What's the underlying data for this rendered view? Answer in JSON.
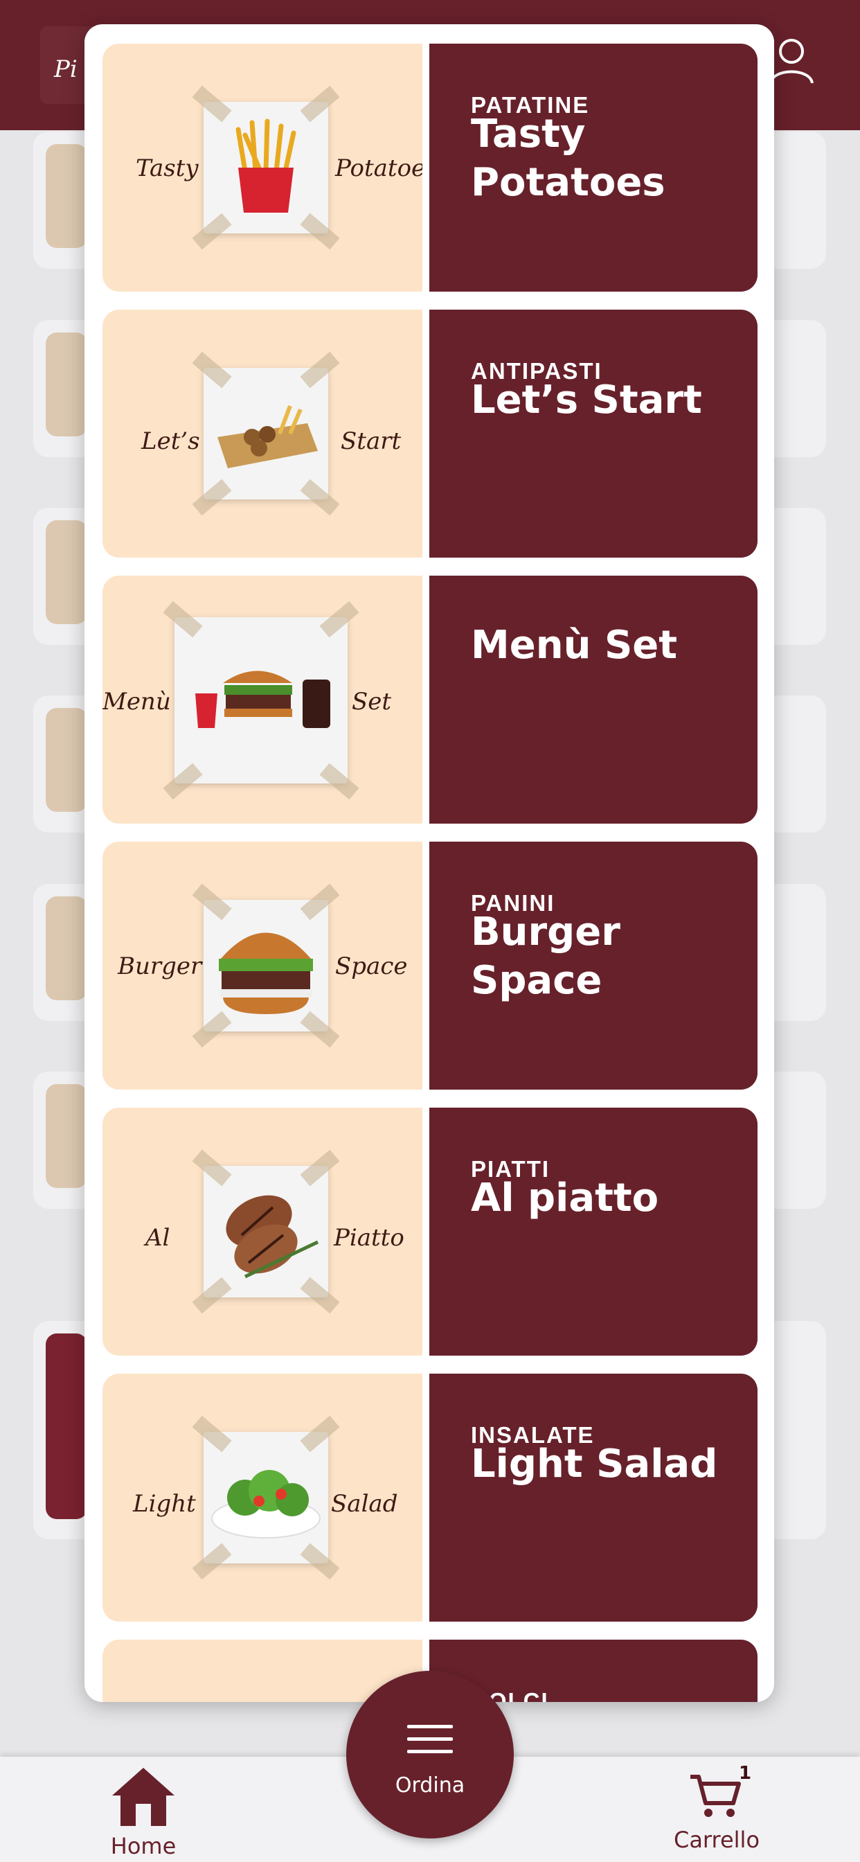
{
  "header": {
    "logo_text": "Pi"
  },
  "modal": {
    "categories": [
      {
        "subtitle": "PATATINE",
        "title": "Tasty Potatoes",
        "script_left": "Tasty",
        "script_right": "Potatoes",
        "image_icon": "fries-icon"
      },
      {
        "subtitle": "ANTIPASTI",
        "title": "Let’s Start",
        "script_left": "Let’s",
        "script_right": "Start",
        "image_icon": "appetizer-box-icon"
      },
      {
        "subtitle": "",
        "title": "Menù Set",
        "script_left": "Menù",
        "script_right": "Set",
        "image_icon": "burger-menu-set-icon"
      },
      {
        "subtitle": "PANINI",
        "title": "Burger Space",
        "script_left": "Burger",
        "script_right": "Space",
        "image_icon": "burger-icon"
      },
      {
        "subtitle": "PIATTI",
        "title": "Al piatto",
        "script_left": "Al",
        "script_right": "Piatto",
        "image_icon": "steak-icon"
      },
      {
        "subtitle": "INSALATE",
        "title": "Light Salad",
        "script_left": "Light",
        "script_right": "Salad",
        "image_icon": "salad-icon"
      },
      {
        "subtitle": "DOLCI",
        "title": "",
        "script_left": "",
        "script_right": "",
        "image_icon": ""
      }
    ]
  },
  "bottom_nav": {
    "home_label": "Home",
    "order_label": "Ordina",
    "cart_label": "Carrello",
    "cart_count": "1"
  },
  "colors": {
    "brand": "#67212b",
    "card_cream": "#fde4c8",
    "background": "#e6e6e8"
  }
}
